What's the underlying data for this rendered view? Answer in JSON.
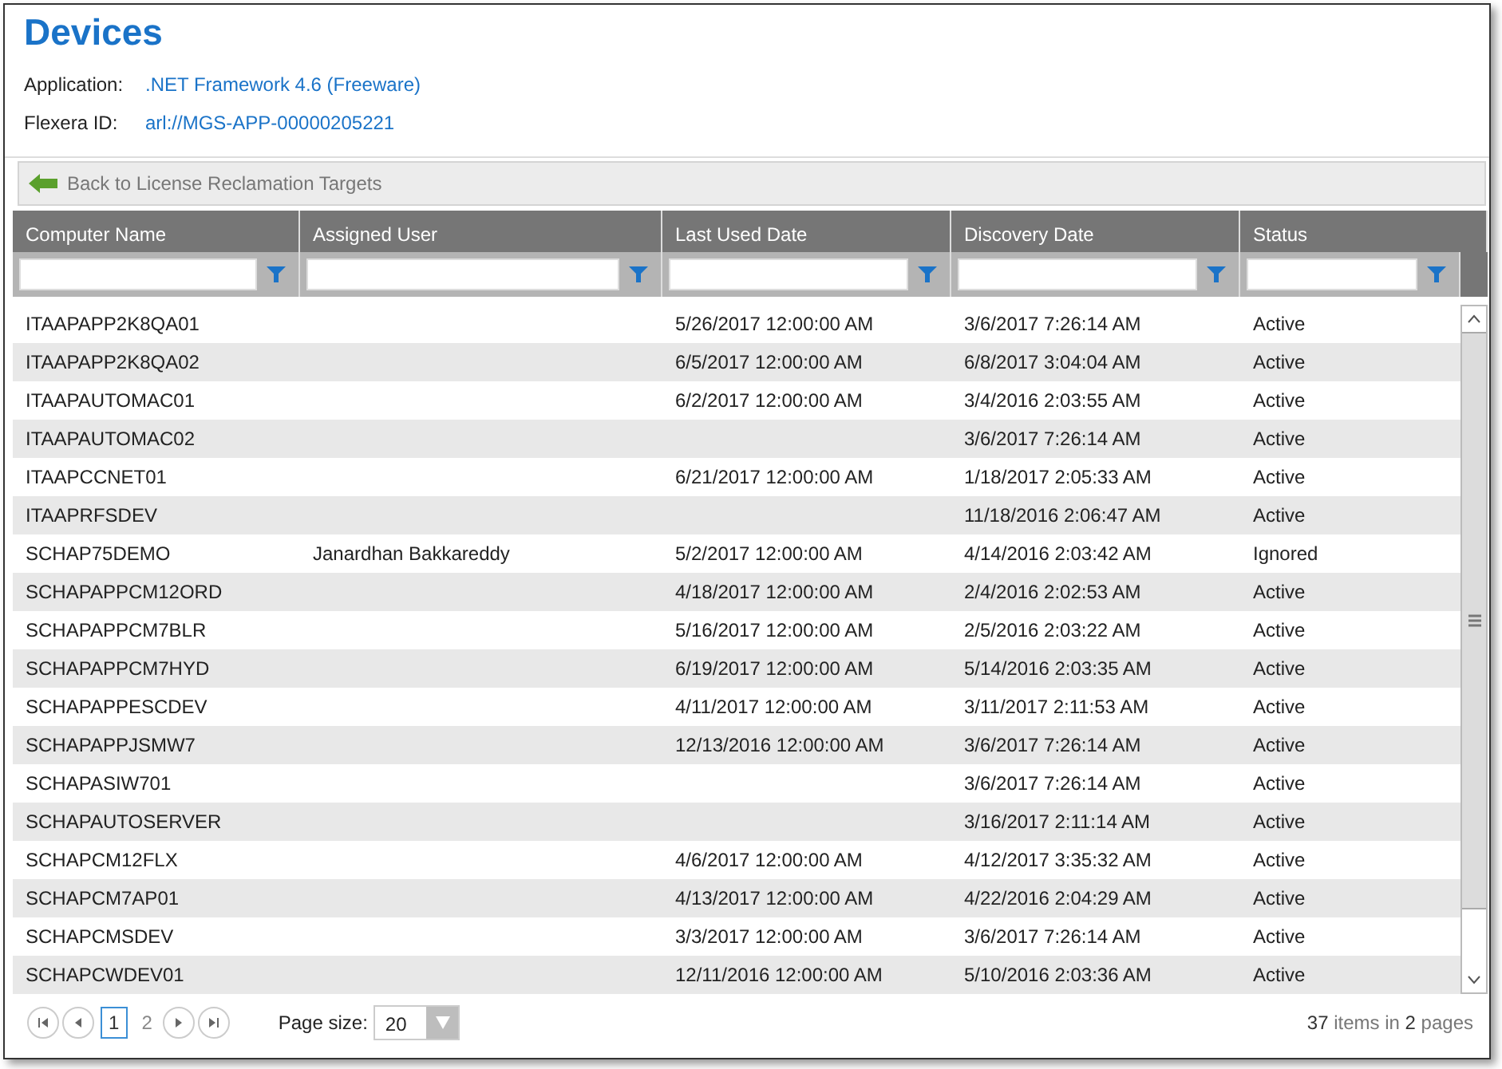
{
  "title": "Devices",
  "info": [
    {
      "label": "Application:",
      "value": ".NET Framework 4.6 (Freeware)"
    },
    {
      "label": "Flexera ID:",
      "value": "arl://MGS-APP-00000205221"
    }
  ],
  "back_button": {
    "label": "Back to License Reclamation Targets"
  },
  "table": {
    "columns": [
      "Computer Name",
      "Assigned User",
      "Last Used Date",
      "Discovery Date",
      "Status"
    ],
    "rows": [
      [
        "ITAAPAPP2K8QA01",
        "",
        "5/26/2017 12:00:00 AM",
        "3/6/2017 7:26:14 AM",
        "Active"
      ],
      [
        "ITAAPAPP2K8QA02",
        "",
        "6/5/2017 12:00:00 AM",
        "6/8/2017 3:04:04 AM",
        "Active"
      ],
      [
        "ITAAPAUTOMAC01",
        "",
        "6/2/2017 12:00:00 AM",
        "3/4/2016 2:03:55 AM",
        "Active"
      ],
      [
        "ITAAPAUTOMAC02",
        "",
        "",
        "3/6/2017 7:26:14 AM",
        "Active"
      ],
      [
        "ITAAPCCNET01",
        "",
        "6/21/2017 12:00:00 AM",
        "1/18/2017 2:05:33 AM",
        "Active"
      ],
      [
        "ITAAPRFSDEV",
        "",
        "",
        "11/18/2016 2:06:47 AM",
        "Active"
      ],
      [
        "SCHAP75DEMO",
        "Janardhan Bakkareddy",
        "5/2/2017 12:00:00 AM",
        "4/14/2016 2:03:42 AM",
        "Ignored"
      ],
      [
        "SCHAPAPPCM12ORD",
        "",
        "4/18/2017 12:00:00 AM",
        "2/4/2016 2:02:53 AM",
        "Active"
      ],
      [
        "SCHAPAPPCM7BLR",
        "",
        "5/16/2017 12:00:00 AM",
        "2/5/2016 2:03:22 AM",
        "Active"
      ],
      [
        "SCHAPAPPCM7HYD",
        "",
        "6/19/2017 12:00:00 AM",
        "5/14/2016 2:03:35 AM",
        "Active"
      ],
      [
        "SCHAPAPPESCDEV",
        "",
        "4/11/2017 12:00:00 AM",
        "3/11/2017 2:11:53 AM",
        "Active"
      ],
      [
        "SCHAPAPPJSMW7",
        "",
        "12/13/2016 12:00:00 AM",
        "3/6/2017 7:26:14 AM",
        "Active"
      ],
      [
        "SCHAPASIW701",
        "",
        "",
        "3/6/2017 7:26:14 AM",
        "Active"
      ],
      [
        "SCHAPAUTOSERVER",
        "",
        "",
        "3/16/2017 2:11:14 AM",
        "Active"
      ],
      [
        "SCHAPCM12FLX",
        "",
        "4/6/2017 12:00:00 AM",
        "4/12/2017 3:35:32 AM",
        "Active"
      ],
      [
        "SCHAPCM7AP01",
        "",
        "4/13/2017 12:00:00 AM",
        "4/22/2016 2:04:29 AM",
        "Active"
      ],
      [
        "SCHAPCMSDEV",
        "",
        "3/3/2017 12:00:00 AM",
        "3/6/2017 7:26:14 AM",
        "Active"
      ],
      [
        "SCHAPCWDEV01",
        "",
        "12/11/2016 12:00:00 AM",
        "5/10/2016 2:03:36 AM",
        "Active"
      ]
    ]
  },
  "pager": {
    "pages": [
      {
        "label": "1",
        "selected": true
      },
      {
        "label": "2",
        "selected": false
      }
    ],
    "page_size_label": "Page size:",
    "page_size": "20",
    "summary": "**37** items in **2** pages"
  }
}
